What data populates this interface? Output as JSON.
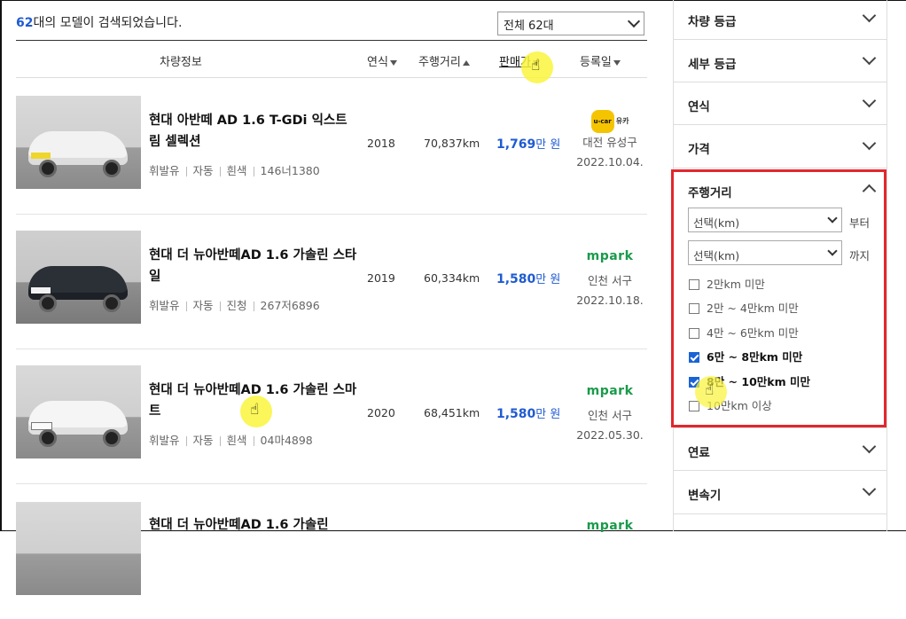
{
  "results": {
    "count_num": "62",
    "count_text": "대의 모델이 검색되었습니다.",
    "sort_selected": "전체 62대",
    "columns": {
      "info": "차량정보",
      "year": "연식",
      "mileage": "주행거리",
      "price": "판매가",
      "date": "등록일"
    },
    "listings": [
      {
        "title": "현대 아반떼 AD 1.6 T-GDi 익스트림 셀렉션",
        "fuel": "휘발유",
        "transmission": "자동",
        "color": "흰색",
        "plate": "146너1380",
        "year": "2018",
        "mileage": "70,837km",
        "price_num": "1,769",
        "price_unit": "만 원",
        "dealer_logo": "u-car 유카",
        "location": "대전 유성구",
        "date": "2022.10.04."
      },
      {
        "title": "현대 더 뉴아반떼AD 1.6 가솔린 스타일",
        "fuel": "휘발유",
        "transmission": "자동",
        "color": "진청",
        "plate": "267저6896",
        "year": "2019",
        "mileage": "60,334km",
        "price_num": "1,580",
        "price_unit": "만 원",
        "dealer_logo": "mpark",
        "location": "인천 서구",
        "date": "2022.10.18."
      },
      {
        "title": "현대 더 뉴아반떼AD 1.6 가솔린 스마트",
        "fuel": "휘발유",
        "transmission": "자동",
        "color": "흰색",
        "plate": "04마4898",
        "year": "2020",
        "mileage": "68,451km",
        "price_num": "1,580",
        "price_unit": "만 원",
        "dealer_logo": "mpark",
        "location": "인천 서구",
        "date": "2022.05.30."
      },
      {
        "title": "현대 더 뉴아반떼AD 1.6 가솔린",
        "dealer_logo": "mpark"
      }
    ]
  },
  "filter": {
    "sections_top": [
      "차량 등급",
      "세부 등급",
      "연식",
      "가격"
    ],
    "mileage": {
      "label": "주행거리",
      "from_placeholder": "선택(km)",
      "from_suffix": "부터",
      "to_placeholder": "선택(km)",
      "to_suffix": "까지",
      "options": [
        {
          "label": "2만km 미만",
          "checked": false
        },
        {
          "label": "2만 ~ 4만km 미만",
          "checked": false
        },
        {
          "label": "4만 ~ 6만km 미만",
          "checked": false
        },
        {
          "label": "6만 ~ 8만km 미만",
          "checked": true
        },
        {
          "label": "8만 ~ 10만km 미만",
          "checked": true
        },
        {
          "label": "10만km 이상",
          "checked": false
        }
      ]
    },
    "sections_bottom": [
      "연료",
      "변속기"
    ]
  },
  "colors": {
    "accent_blue": "#1f5bd1",
    "highlight_red": "#e3262d",
    "mpark_green": "#1a9a4b",
    "cursor_yellow": "#faf53c"
  }
}
